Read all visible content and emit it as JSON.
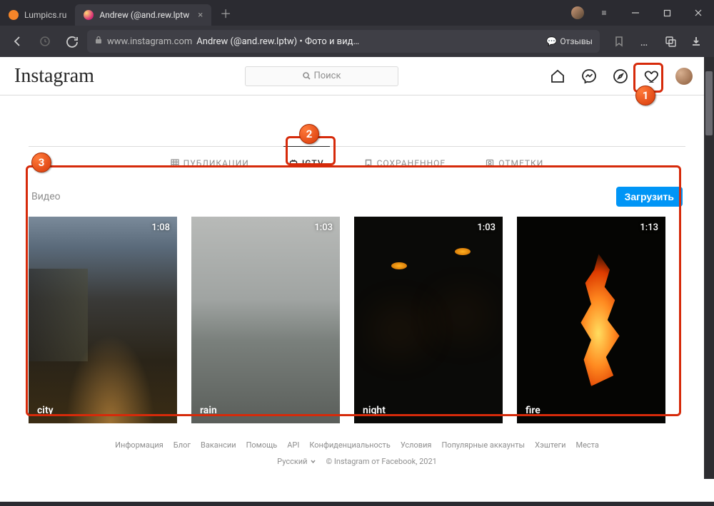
{
  "browser": {
    "tabs": [
      {
        "title": "Lumpics.ru"
      },
      {
        "title": "Andrew (@and.rew.lptw"
      }
    ],
    "url_host": "www.instagram.com",
    "url_title": "Andrew (@and.rew.lptw) • Фото и вид…",
    "reviews_label": "Отзывы"
  },
  "ig": {
    "logo": "Instagram",
    "search_placeholder": "Поиск"
  },
  "tabs": {
    "posts": "ПУБЛИКАЦИИ",
    "igtv": "IGTV",
    "saved": "СОХРАНЕННОЕ",
    "tagged": "ОТМЕТКИ"
  },
  "videos": {
    "label": "Видео",
    "upload": "Загрузить",
    "items": [
      {
        "title": "city",
        "duration": "1:08"
      },
      {
        "title": "rain",
        "duration": "1:03"
      },
      {
        "title": "night",
        "duration": "1:03"
      },
      {
        "title": "fire",
        "duration": "1:13"
      }
    ]
  },
  "footer": {
    "links": [
      "Информация",
      "Блог",
      "Вакансии",
      "Помощь",
      "API",
      "Конфиденциальность",
      "Условия",
      "Популярные аккаунты",
      "Хэштеги",
      "Места"
    ],
    "language": "Русский",
    "copyright": "© Instagram от Facebook, 2021"
  },
  "annotations": {
    "a1": "1",
    "a2": "2",
    "a3": "3"
  }
}
